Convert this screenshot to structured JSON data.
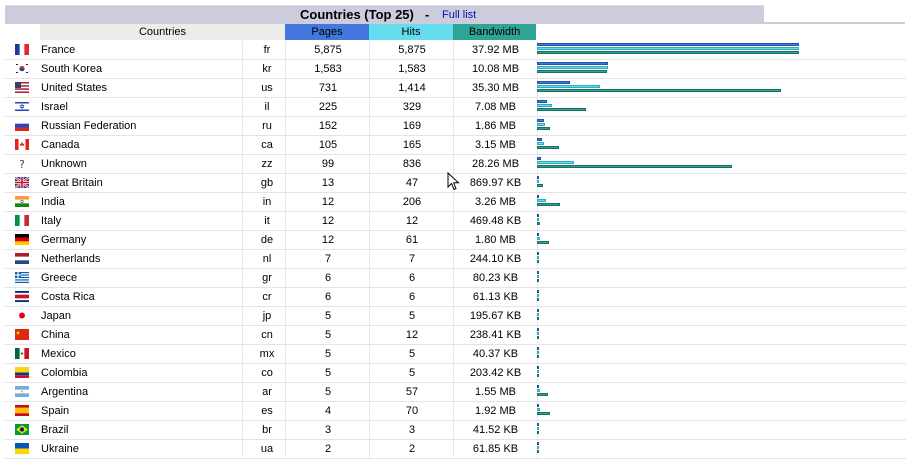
{
  "header": {
    "title": "Countries (Top 25)",
    "separator": "-",
    "full_list_label": "Full list"
  },
  "columns": {
    "countries": "Countries",
    "pages": "Pages",
    "hits": "Hits",
    "bandwidth": "Bandwidth"
  },
  "colors": {
    "pages": "#4477dd",
    "hits": "#66ddee",
    "bandwidth": "#2ea495",
    "title_bg": "#ccccdd"
  },
  "max": {
    "pages": 5875,
    "hits": 5875,
    "bandwidth_mb": 37.92
  },
  "rows": [
    {
      "flag": "fr",
      "name": "France",
      "code": "fr",
      "pages": "5,875",
      "hits": "5,875",
      "bandwidth": "37.92 MB",
      "p": 5875,
      "h": 5875,
      "b": 37.92
    },
    {
      "flag": "kr",
      "name": "South Korea",
      "code": "kr",
      "pages": "1,583",
      "hits": "1,583",
      "bandwidth": "10.08 MB",
      "p": 1583,
      "h": 1583,
      "b": 10.08
    },
    {
      "flag": "us",
      "name": "United States",
      "code": "us",
      "pages": "731",
      "hits": "1,414",
      "bandwidth": "35.30 MB",
      "p": 731,
      "h": 1414,
      "b": 35.3
    },
    {
      "flag": "il",
      "name": "Israel",
      "code": "il",
      "pages": "225",
      "hits": "329",
      "bandwidth": "7.08 MB",
      "p": 225,
      "h": 329,
      "b": 7.08
    },
    {
      "flag": "ru",
      "name": "Russian Federation",
      "code": "ru",
      "pages": "152",
      "hits": "169",
      "bandwidth": "1.86 MB",
      "p": 152,
      "h": 169,
      "b": 1.86
    },
    {
      "flag": "ca",
      "name": "Canada",
      "code": "ca",
      "pages": "105",
      "hits": "165",
      "bandwidth": "3.15 MB",
      "p": 105,
      "h": 165,
      "b": 3.15
    },
    {
      "flag": "zz",
      "name": "Unknown",
      "code": "zz",
      "pages": "99",
      "hits": "836",
      "bandwidth": "28.26 MB",
      "p": 99,
      "h": 836,
      "b": 28.26
    },
    {
      "flag": "gb",
      "name": "Great Britain",
      "code": "gb",
      "pages": "13",
      "hits": "47",
      "bandwidth": "869.97 KB",
      "p": 13,
      "h": 47,
      "b": 0.85
    },
    {
      "flag": "in",
      "name": "India",
      "code": "in",
      "pages": "12",
      "hits": "206",
      "bandwidth": "3.26 MB",
      "p": 12,
      "h": 206,
      "b": 3.26
    },
    {
      "flag": "it",
      "name": "Italy",
      "code": "it",
      "pages": "12",
      "hits": "12",
      "bandwidth": "469.48 KB",
      "p": 12,
      "h": 12,
      "b": 0.46
    },
    {
      "flag": "de",
      "name": "Germany",
      "code": "de",
      "pages": "12",
      "hits": "61",
      "bandwidth": "1.80 MB",
      "p": 12,
      "h": 61,
      "b": 1.8
    },
    {
      "flag": "nl",
      "name": "Netherlands",
      "code": "nl",
      "pages": "7",
      "hits": "7",
      "bandwidth": "244.10 KB",
      "p": 7,
      "h": 7,
      "b": 0.24
    },
    {
      "flag": "gr",
      "name": "Greece",
      "code": "gr",
      "pages": "6",
      "hits": "6",
      "bandwidth": "80.23 KB",
      "p": 6,
      "h": 6,
      "b": 0.08
    },
    {
      "flag": "cr",
      "name": "Costa Rica",
      "code": "cr",
      "pages": "6",
      "hits": "6",
      "bandwidth": "61.13 KB",
      "p": 6,
      "h": 6,
      "b": 0.06
    },
    {
      "flag": "jp",
      "name": "Japan",
      "code": "jp",
      "pages": "5",
      "hits": "5",
      "bandwidth": "195.67 KB",
      "p": 5,
      "h": 5,
      "b": 0.19
    },
    {
      "flag": "cn",
      "name": "China",
      "code": "cn",
      "pages": "5",
      "hits": "12",
      "bandwidth": "238.41 KB",
      "p": 5,
      "h": 12,
      "b": 0.23
    },
    {
      "flag": "mx",
      "name": "Mexico",
      "code": "mx",
      "pages": "5",
      "hits": "5",
      "bandwidth": "40.37 KB",
      "p": 5,
      "h": 5,
      "b": 0.04
    },
    {
      "flag": "co",
      "name": "Colombia",
      "code": "co",
      "pages": "5",
      "hits": "5",
      "bandwidth": "203.42 KB",
      "p": 5,
      "h": 5,
      "b": 0.2
    },
    {
      "flag": "ar",
      "name": "Argentina",
      "code": "ar",
      "pages": "5",
      "hits": "57",
      "bandwidth": "1.55 MB",
      "p": 5,
      "h": 57,
      "b": 1.55
    },
    {
      "flag": "es",
      "name": "Spain",
      "code": "es",
      "pages": "4",
      "hits": "70",
      "bandwidth": "1.92 MB",
      "p": 4,
      "h": 70,
      "b": 1.92
    },
    {
      "flag": "br",
      "name": "Brazil",
      "code": "br",
      "pages": "3",
      "hits": "3",
      "bandwidth": "41.52 KB",
      "p": 3,
      "h": 3,
      "b": 0.04
    },
    {
      "flag": "ua",
      "name": "Ukraine",
      "code": "ua",
      "pages": "2",
      "hits": "2",
      "bandwidth": "61.85 KB",
      "p": 2,
      "h": 2,
      "b": 0.06
    }
  ]
}
